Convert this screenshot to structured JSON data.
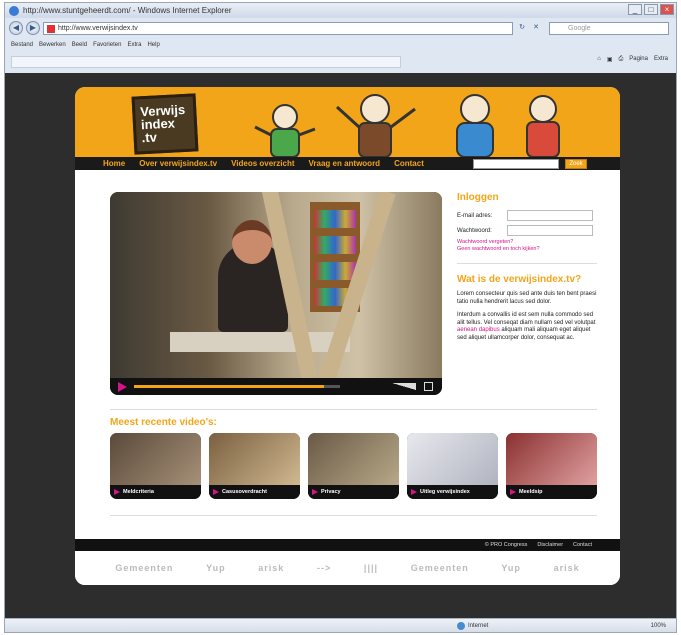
{
  "browser": {
    "title": "http://www.stuntgeheerdt.com/ - Windows Internet Explorer",
    "address": "http://www.verwijsindex.tv",
    "search_placeholder": "Google",
    "menu": [
      "Bestand",
      "Bewerken",
      "Beeld",
      "Favorieten",
      "Extra",
      "Help"
    ],
    "commands": [
      "Pagina",
      "Extra"
    ],
    "status_zone": "Internet",
    "zoom": "100%"
  },
  "site": {
    "logo_line1": "Verwijs",
    "logo_line2": "index",
    "logo_line3": ".tv",
    "nav": [
      "Home",
      "Over verwijsindex.tv",
      "Videos overzicht",
      "Vraag en antwoord",
      "Contact"
    ],
    "search_button": "Zoek"
  },
  "video": {
    "progress": 0.92
  },
  "login": {
    "title": "Inloggen",
    "email_label": "E-mail adres:",
    "password_label": "Wachtwoord:",
    "forgot_link": "Wachtwoord vergeten?",
    "register_link": "Geen wachtwoord en toch kijken?"
  },
  "about": {
    "title": "Wat is de verwijsindex.tv?",
    "para1": "Lorem consecteur quis sed ante duis ten bent praesi tatio nulla hendrerit lacus sed dolor.",
    "para2_pre": "Interdum a convallis id est sem nulla commodo sed alit tellus. Vel conseqat diam nullam sed vel volutpat",
    "para2_link": "aenean dapibus",
    "para2_post": "aliquam mali aliquam eget aliquet sed aliquet ullamcorper dolor, consequat ac."
  },
  "recent": {
    "title": "Meest recente video's:",
    "items": [
      {
        "label": "Meldcriteria",
        "color": "#7a6a5a"
      },
      {
        "label": "Casusoverdracht",
        "color": "#9a8060"
      },
      {
        "label": "Privacy",
        "color": "#8a7a66"
      },
      {
        "label": "Uitleg verwijsindex",
        "color": "#c0c4cc"
      },
      {
        "label": "Meeldsip",
        "color": "#b06060"
      }
    ]
  },
  "footer": {
    "links": [
      "© PRO Congress",
      "Disclaimer",
      "Contact"
    ]
  },
  "sponsors": [
    "Gemeenten",
    "Yup",
    "arisk",
    "-->",
    "||||",
    "Gemeenten",
    "Yup",
    "arisk"
  ]
}
